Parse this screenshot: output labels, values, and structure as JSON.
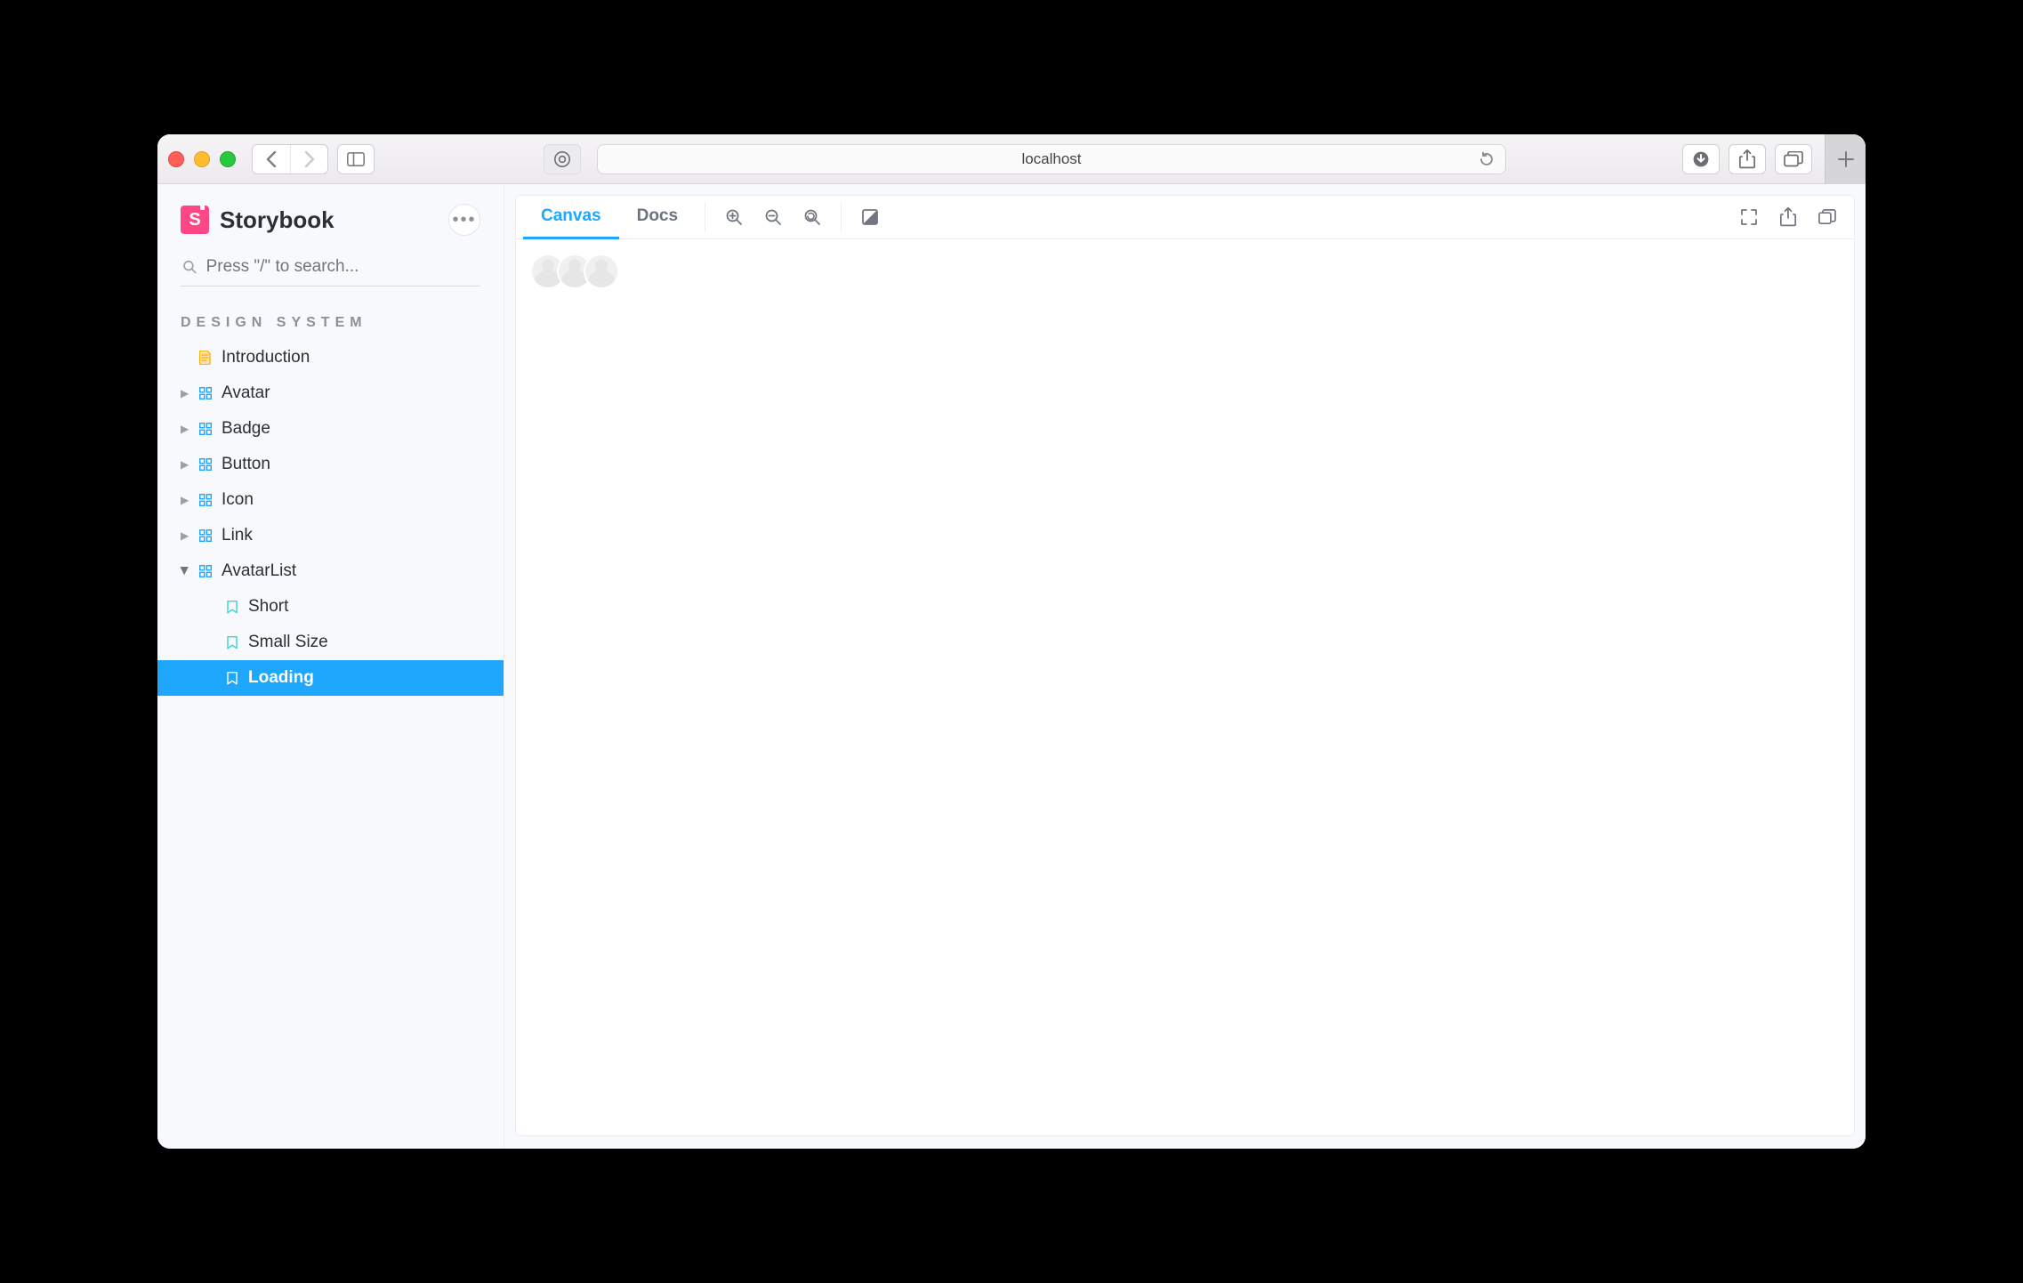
{
  "browser": {
    "url": "localhost"
  },
  "brand": {
    "name": "Storybook"
  },
  "search": {
    "placeholder": "Press \"/\" to search..."
  },
  "section_title": "DESIGN SYSTEM",
  "tree": {
    "intro": "Introduction",
    "avatar": "Avatar",
    "badge": "Badge",
    "button": "Button",
    "icon": "Icon",
    "link": "Link",
    "avatarlist": "AvatarList",
    "stories": {
      "short": "Short",
      "small": "Small Size",
      "loading": "Loading"
    }
  },
  "tabs": {
    "canvas": "Canvas",
    "docs": "Docs"
  },
  "canvas": {
    "avatar_count": 3
  }
}
